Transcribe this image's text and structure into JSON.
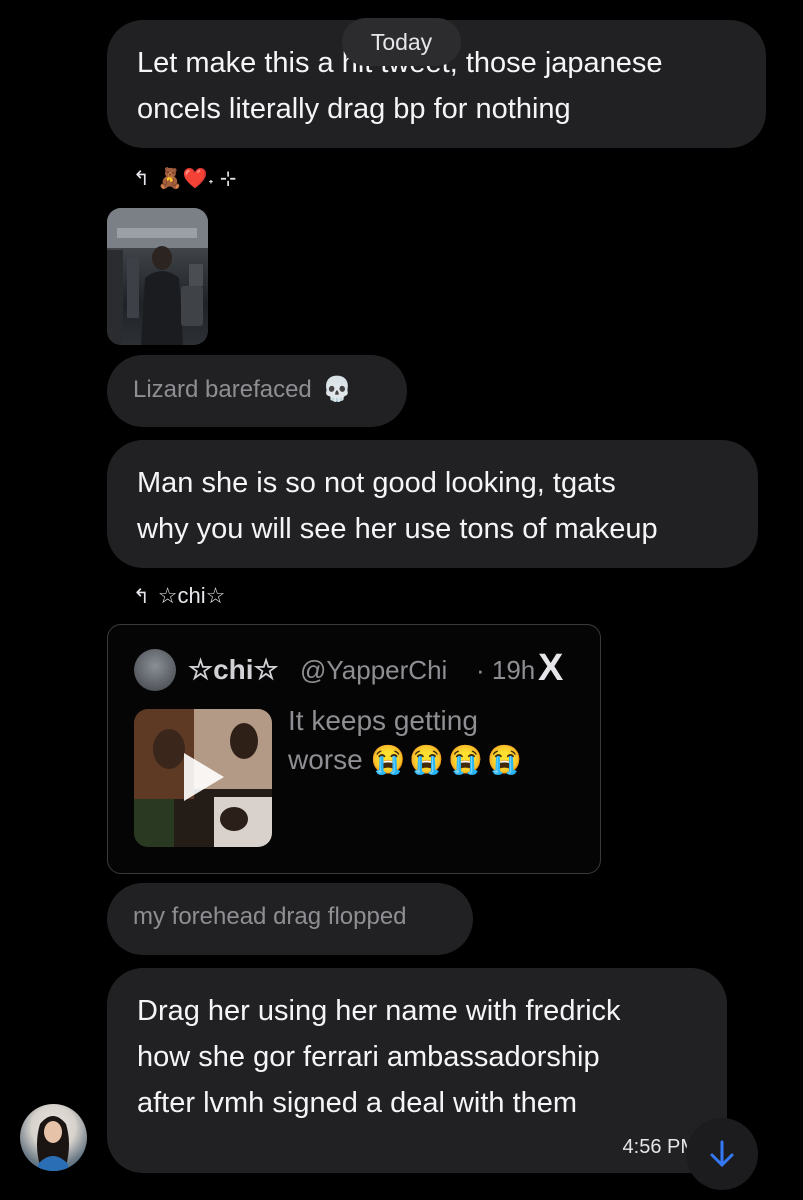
{
  "date_pill": "Today",
  "messages": {
    "m1": "Let make this a hit tweet, those japanese\noncels literally drag bp for nothing",
    "reply1_decoration": "🧸❤️˖ ⊹",
    "reply2_text": "Lizard barefaced",
    "reply2_emoji": "💀",
    "m2": "Man she is so not good  looking, tgats\nwhy you will see her use tons of makeup",
    "reply3_name": "☆chi☆",
    "reply4_text": "my forehead drag flopped",
    "m3": "Drag her using her name with fredrick\nhow she gor ferrari ambassadorship\nafter lvmh signed a deal with them",
    "m3_time": "4:56 PM"
  },
  "tweet": {
    "display_name": "☆chi☆",
    "handle": "@YapperChi",
    "age": "· 19h",
    "text_line1": "It keeps getting",
    "text_line2": "worse",
    "emoji": "😭😭😭😭",
    "logo": "X"
  },
  "icons": {
    "reply": "reply-arrow-icon",
    "play": "play-icon",
    "scroll": "arrow-down-icon",
    "avatar": "avatar"
  },
  "colors": {
    "bubble": "#212123",
    "background": "#000000",
    "accent_blue": "#3478f6"
  }
}
